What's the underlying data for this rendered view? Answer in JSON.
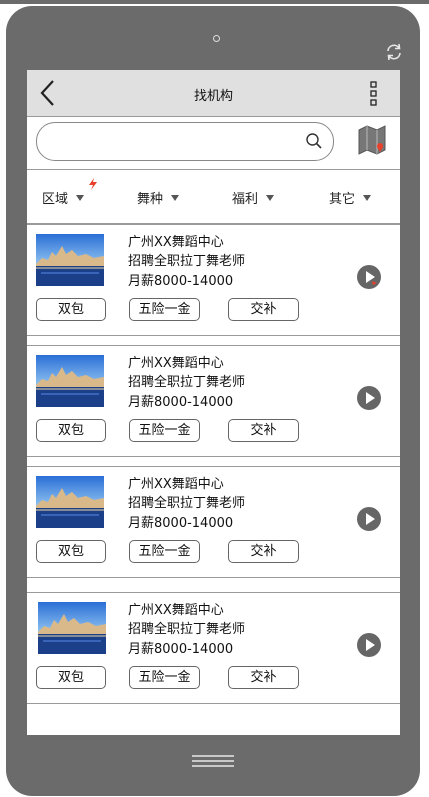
{
  "header": {
    "title": "找机构"
  },
  "search": {
    "placeholder": ""
  },
  "filters": [
    {
      "label": "区域"
    },
    {
      "label": "舞种"
    },
    {
      "label": "福利"
    },
    {
      "label": "其它"
    }
  ],
  "listings": [
    {
      "org": "广州XX舞蹈中心",
      "position": "招聘全职拉丁舞老师",
      "salary": "月薪8000-14000",
      "tags": [
        "双包",
        "五险一金",
        "交补"
      ]
    },
    {
      "org": "广州XX舞蹈中心",
      "position": "招聘全职拉丁舞老师",
      "salary": "月薪8000-14000",
      "tags": [
        "双包",
        "五险一金",
        "交补"
      ]
    },
    {
      "org": "广州XX舞蹈中心",
      "position": "招聘全职拉丁舞老师",
      "salary": "月薪8000-14000",
      "tags": [
        "双包",
        "五险一金",
        "交补"
      ]
    },
    {
      "org": "广州XX舞蹈中心",
      "position": "招聘全职拉丁舞老师",
      "salary": "月薪8000-14000",
      "tags": [
        "双包",
        "五险一金",
        "交补"
      ]
    }
  ],
  "colors": {
    "device": "#6b6b6b",
    "header": "#e0e0e0",
    "accent": "#e8402a"
  },
  "icons": [
    "back-arrow-icon",
    "more-vertical-icon",
    "search-icon",
    "map-icon",
    "play-icon",
    "rotate-icon",
    "hot-badge-icon"
  ]
}
